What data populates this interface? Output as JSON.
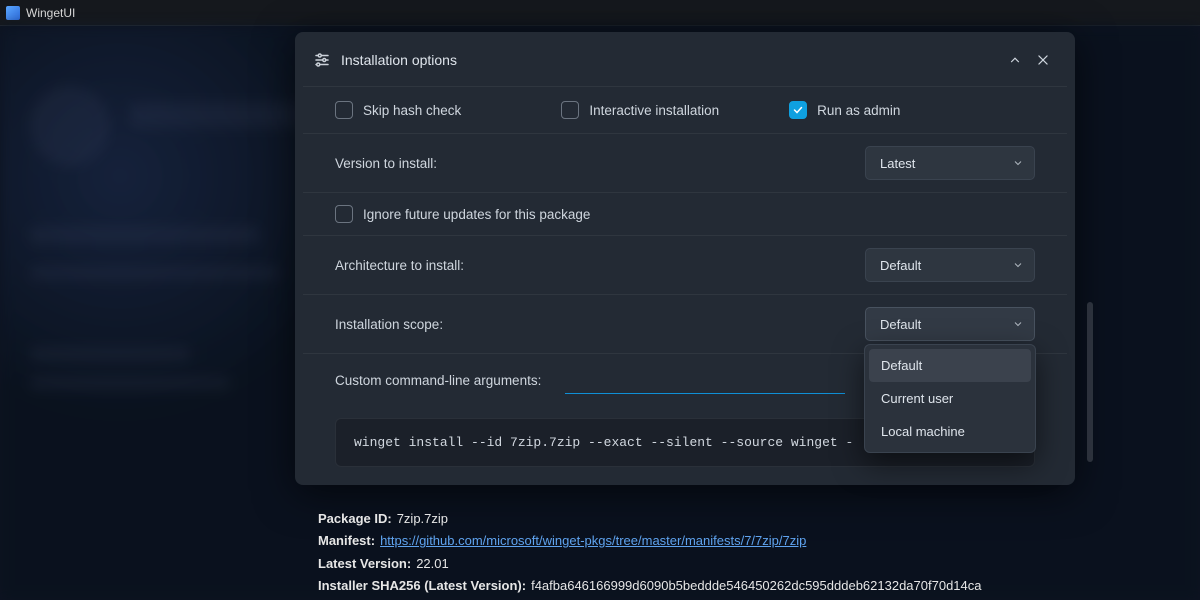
{
  "app": {
    "title": "WingetUI"
  },
  "panel": {
    "title": "Installation options",
    "skipHash": {
      "label": "Skip hash check",
      "checked": false
    },
    "interactive": {
      "label": "Interactive installation",
      "checked": false
    },
    "runAdmin": {
      "label": "Run as admin",
      "checked": true
    },
    "versionLabel": "Version to install:",
    "versionValue": "Latest",
    "ignoreUpdates": {
      "label": "Ignore future updates for this package",
      "checked": false
    },
    "archLabel": "Architecture to install:",
    "archValue": "Default",
    "scopeLabel": "Installation scope:",
    "scopeValue": "Default",
    "scopeOptions": [
      "Default",
      "Current user",
      "Local machine"
    ],
    "customArgsLabel": "Custom command-line arguments:",
    "customArgsValue": "",
    "command": "winget install --id 7zip.7zip --exact --silent --source winget -"
  },
  "details": {
    "packageIdLabel": "Package ID:",
    "packageId": "7zip.7zip",
    "manifestLabel": "Manifest:",
    "manifestUrl": "https://github.com/microsoft/winget-pkgs/tree/master/manifests/7/7zip/7zip",
    "latestVersionLabel": "Latest Version:",
    "latestVersion": "22.01",
    "shaLabel": "Installer SHA256 (Latest Version):",
    "sha": "f4afba646166999d6090b5beddde546450262dc595dddeb62132da70f70d14ca"
  }
}
